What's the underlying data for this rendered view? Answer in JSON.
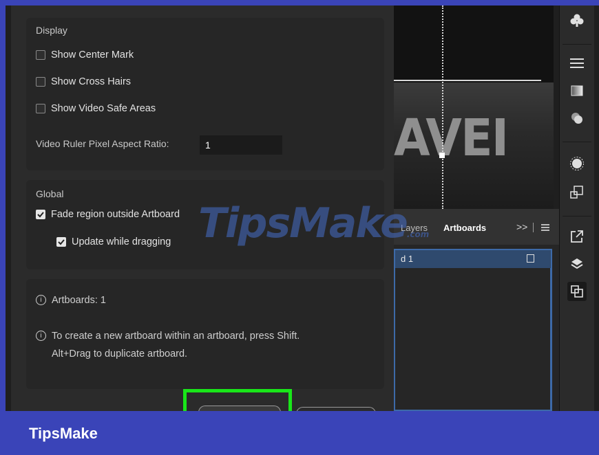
{
  "display": {
    "title": "Display",
    "options": [
      {
        "label": "Show Center Mark",
        "checked": false
      },
      {
        "label": "Show Cross Hairs",
        "checked": false
      },
      {
        "label": "Show Video Safe Areas",
        "checked": false
      }
    ],
    "ratio_label": "Video Ruler Pixel Aspect Ratio:",
    "ratio_value": "1"
  },
  "global": {
    "title": "Global",
    "fade_label": "Fade region outside Artboard",
    "fade_checked": true,
    "update_label": "Update while dragging",
    "update_checked": true
  },
  "info": {
    "artboards_count": "Artboards: 1",
    "tip_line1": "To create a new artboard within an artboard, press Shift.",
    "tip_line2": "Alt+Drag to duplicate artboard."
  },
  "canvas": {
    "text": "AVEI"
  },
  "panel": {
    "tabs": [
      "Layers",
      "Artboards"
    ],
    "active_tab": "Artboards",
    "more": ">>",
    "item_label": "d 1"
  },
  "toolbar": {
    "icons": [
      "club-icon",
      "properties-icon",
      "gradient-icon",
      "shapes-icon",
      "brightness-icon",
      "transform-icon",
      "export-icon",
      "layers-icon",
      "artboards-icon"
    ]
  },
  "watermark": {
    "text": "TipsMake",
    "suffix": ".com"
  },
  "footer": {
    "brand": "TipsMake"
  },
  "colors": {
    "footer_bg": "#3a44b8",
    "highlight": "#19e619",
    "selection": "#2f4a6e"
  }
}
